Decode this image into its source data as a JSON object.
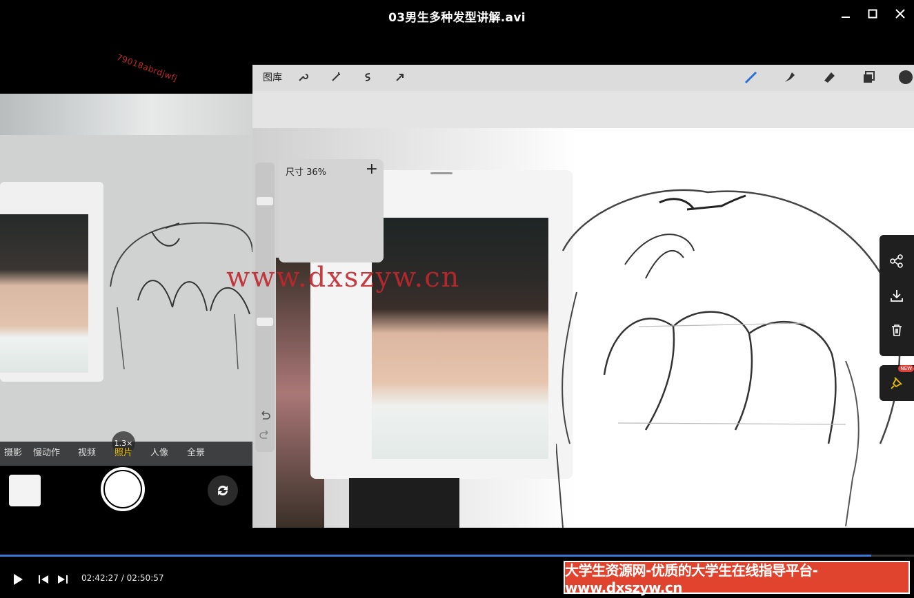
{
  "window": {
    "title": "03男生多种发型讲解.avi",
    "minimize_icon": "minimize-icon",
    "maximize_icon": "maximize-icon",
    "close_icon": "close-icon"
  },
  "video": {
    "small_watermark": "79018abrdjwfj",
    "big_watermark": "www.dxszyw.cn",
    "phone": {
      "zoom": "1.3×",
      "modes": [
        "摄影",
        "慢动作",
        "视频",
        "照片",
        "人像",
        "全景"
      ],
      "active_mode": "照片"
    },
    "tablet": {
      "gallery_label": "图库",
      "size_label": "尺寸 36%",
      "size_plus": "+"
    }
  },
  "side_panel": {
    "share_icon": "share-icon",
    "download_icon": "download-icon",
    "delete_icon": "trash-icon",
    "pin_icon": "pin-icon",
    "new_badge": "NEW"
  },
  "player": {
    "current_time": "02:42:27",
    "total_time": "02:50:57",
    "progress_fraction": 0.953,
    "banner": "大学生资源网-优质的大学生在线指导平台-www.dxszyw.cn"
  },
  "colors": {
    "accent": "#3b78d8",
    "banner_bg": "#e0442e",
    "watermark": "#c0272d",
    "active_mode": "#f2c300"
  }
}
